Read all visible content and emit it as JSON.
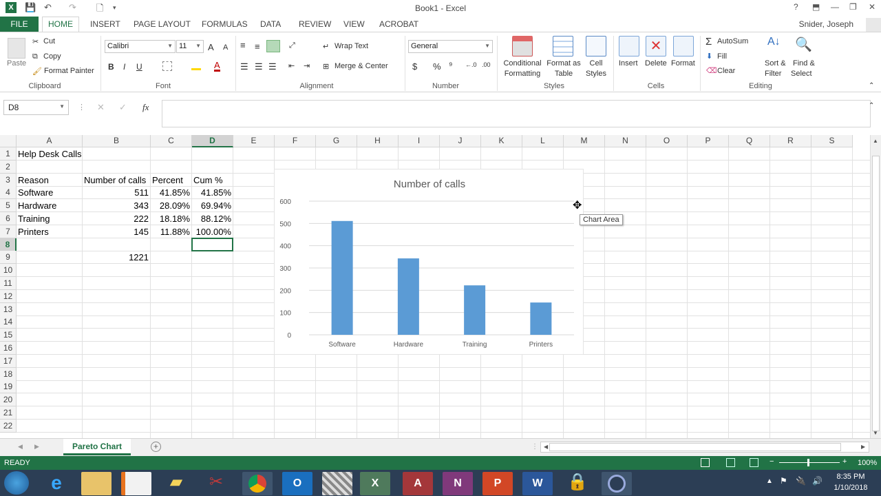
{
  "window": {
    "title": "Book1 - Excel",
    "help": "?",
    "minimize": "—",
    "restore": "❐",
    "close": "✕"
  },
  "ribbon_tabs": [
    "FILE",
    "HOME",
    "INSERT",
    "PAGE LAYOUT",
    "FORMULAS",
    "DATA",
    "REVIEW",
    "VIEW",
    "ACROBAT"
  ],
  "user": "Snider, Joseph",
  "clipboard": {
    "paste": "Paste",
    "cut": "Cut",
    "copy": "Copy",
    "format_painter": "Format Painter",
    "label": "Clipboard"
  },
  "font": {
    "name": "Calibri",
    "size": "11",
    "label": "Font",
    "bold": "B",
    "italic": "I",
    "underline": "U",
    "grow": "A",
    "shrink": "A",
    "font_color": "A"
  },
  "alignment": {
    "wrap": "Wrap Text",
    "merge": "Merge & Center",
    "label": "Alignment"
  },
  "number": {
    "format": "General",
    "label": "Number",
    "currency": "$",
    "percent": "%",
    "comma": "⁹"
  },
  "styles": {
    "conditional": "Conditional",
    "conditional2": "Formatting",
    "format_table": "Format as",
    "format_table2": "Table",
    "cell_styles": "Cell",
    "cell_styles2": "Styles",
    "label": "Styles"
  },
  "cells": {
    "insert": "Insert",
    "delete": "Delete",
    "format": "Format",
    "label": "Cells"
  },
  "editing": {
    "autosum": "AutoSum",
    "fill": "Fill",
    "clear": "Clear",
    "sort": "Sort &",
    "sort2": "Filter",
    "find": "Find &",
    "find2": "Select",
    "label": "Editing"
  },
  "namebox": "D8",
  "fx": "fx",
  "columns": [
    "A",
    "B",
    "C",
    "D",
    "E",
    "F",
    "G",
    "H",
    "I",
    "J",
    "K",
    "L",
    "M",
    "N",
    "O",
    "P",
    "Q",
    "R",
    "S"
  ],
  "rows": [
    "1",
    "2",
    "3",
    "4",
    "5",
    "6",
    "7",
    "8",
    "9",
    "10",
    "11",
    "12",
    "13",
    "14",
    "15",
    "16",
    "17",
    "18",
    "19",
    "20",
    "21",
    "22"
  ],
  "cells_data": {
    "a1": "Help Desk Calls",
    "a3": "Reason",
    "b3": "Number of calls",
    "c3": "Percent",
    "d3": "Cum %",
    "a4": "Software",
    "b4": "511",
    "c4": "41.85%",
    "d4": "41.85%",
    "a5": "Hardware",
    "b5": "343",
    "c5": "28.09%",
    "d5": "69.94%",
    "a6": "Training",
    "b6": "222",
    "c6": "18.18%",
    "d6": "88.12%",
    "a7": "Printers",
    "b7": "145",
    "c7": "11.88%",
    "d7": "100.00%",
    "b9": "1221"
  },
  "tooltip": "Chart Area",
  "chart_data": {
    "type": "bar",
    "title": "Number of calls",
    "categories": [
      "Software",
      "Hardware",
      "Training",
      "Printers"
    ],
    "values": [
      511,
      343,
      222,
      145
    ],
    "ylim": [
      0,
      600
    ],
    "yticks": [
      "0",
      "100",
      "200",
      "300",
      "400",
      "500",
      "600"
    ],
    "grid": true,
    "color": "#5B9BD5"
  },
  "sheet_tab": "Pareto Chart",
  "status": {
    "ready": "READY",
    "zoom": "100%"
  },
  "clock": {
    "time": "8:35 PM",
    "date": "1/10/2018"
  },
  "colors": {
    "excel_green": "#217346",
    "bar": "#5B9BD5"
  }
}
